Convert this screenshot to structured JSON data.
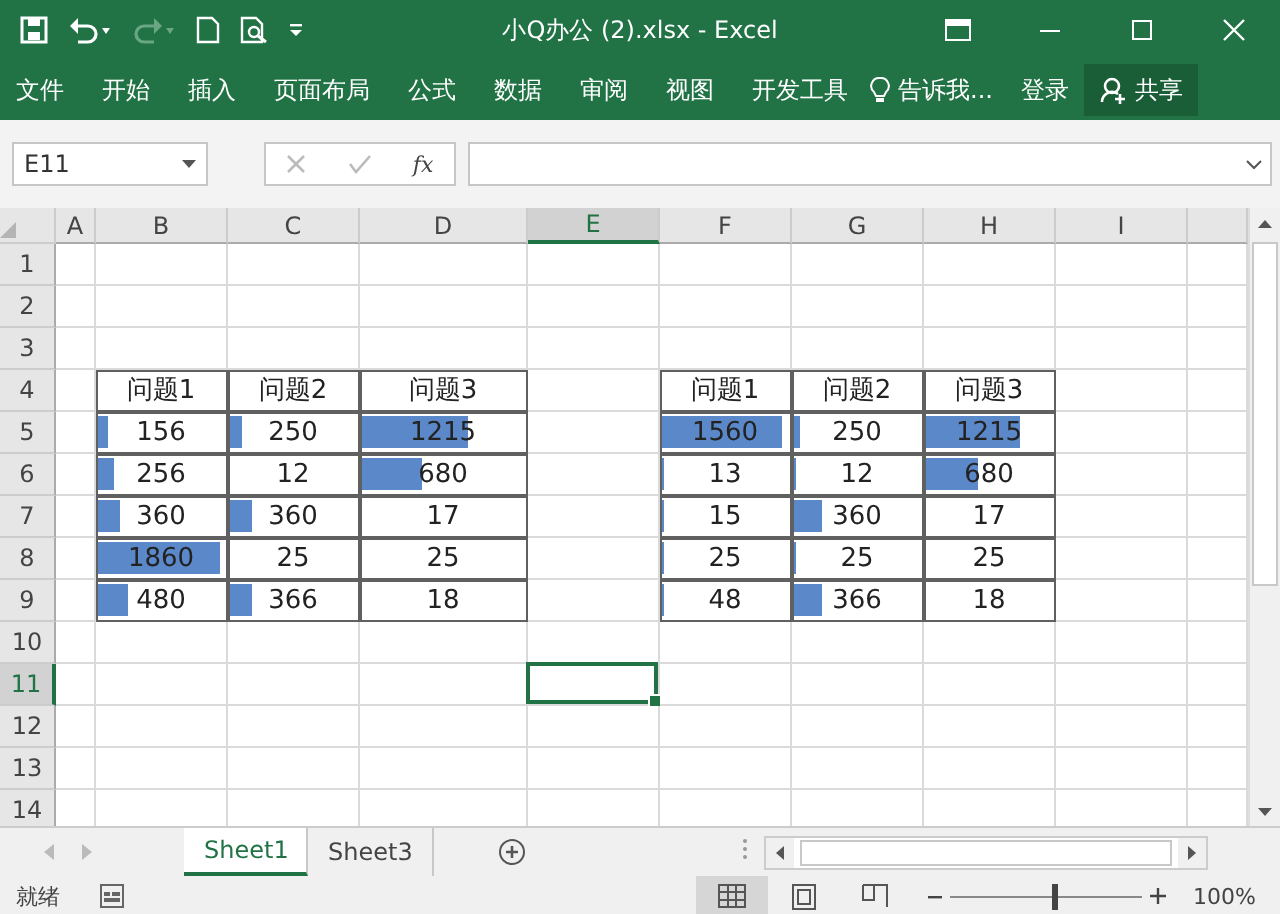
{
  "window": {
    "title": "小Q办公 (2).xlsx - Excel"
  },
  "ribbon": {
    "tabs": [
      {
        "label": "文件",
        "selected": false
      },
      {
        "label": "开始",
        "selected": false
      },
      {
        "label": "插入",
        "selected": false
      },
      {
        "label": "页面布局",
        "selected": false
      },
      {
        "label": "公式",
        "selected": false
      },
      {
        "label": "数据",
        "selected": false
      },
      {
        "label": "审阅",
        "selected": false
      },
      {
        "label": "视图",
        "selected": false
      },
      {
        "label": "开发工具",
        "selected": false
      }
    ],
    "tell_me": "告诉我...",
    "sign_in": "登录",
    "share": "共享"
  },
  "formula_bar": {
    "name_box": "E11",
    "function_label": "fx"
  },
  "sheet": {
    "columns": [
      {
        "label": "A",
        "selected": false
      },
      {
        "label": "B",
        "selected": false
      },
      {
        "label": "C",
        "selected": false
      },
      {
        "label": "D",
        "selected": false
      },
      {
        "label": "E",
        "selected": true
      },
      {
        "label": "F",
        "selected": false
      },
      {
        "label": "G",
        "selected": false
      },
      {
        "label": "H",
        "selected": false
      },
      {
        "label": "I",
        "selected": false
      }
    ],
    "rows": [
      {
        "label": "1",
        "selected": false
      },
      {
        "label": "2",
        "selected": false
      },
      {
        "label": "3",
        "selected": false
      },
      {
        "label": "4",
        "selected": false
      },
      {
        "label": "5",
        "selected": false
      },
      {
        "label": "6",
        "selected": false
      },
      {
        "label": "7",
        "selected": false
      },
      {
        "label": "8",
        "selected": false
      },
      {
        "label": "9",
        "selected": false
      },
      {
        "label": "10",
        "selected": false
      },
      {
        "label": "11",
        "selected": true
      },
      {
        "label": "12",
        "selected": false
      },
      {
        "label": "13",
        "selected": false
      },
      {
        "label": "14",
        "selected": false
      }
    ],
    "tables": [
      {
        "headers": [
          "问题1",
          "问题2",
          "问题3"
        ],
        "rows": [
          [
            {
              "value": "156",
              "level": 0.08
            },
            {
              "value": "250",
              "level": 0.1
            },
            {
              "value": "1215",
              "level": 0.66
            }
          ],
          [
            {
              "value": "256",
              "level": 0.12
            },
            {
              "value": "12"
            },
            {
              "value": "680",
              "level": 0.37
            }
          ],
          [
            {
              "value": "360",
              "level": 0.17
            },
            {
              "value": "360",
              "level": 0.17
            },
            {
              "value": "17"
            }
          ],
          [
            {
              "value": "1860",
              "level": 0.97
            },
            {
              "value": "25"
            },
            {
              "value": "25"
            }
          ],
          [
            {
              "value": "480",
              "level": 0.24
            },
            {
              "value": "366",
              "level": 0.17
            },
            {
              "value": "18"
            }
          ]
        ]
      },
      {
        "headers": [
          "问题1",
          "问题2",
          "问题3"
        ],
        "rows": [
          [
            {
              "value": "1560",
              "level": 0.95
            },
            {
              "value": "250",
              "level": 0.05
            },
            {
              "value": "1215",
              "level": 0.74
            }
          ],
          [
            {
              "value": "13",
              "level": 0.02
            },
            {
              "value": "12",
              "level": 0.02
            },
            {
              "value": "680",
              "level": 0.42
            }
          ],
          [
            {
              "value": "15",
              "level": 0.02
            },
            {
              "value": "360",
              "level": 0.22
            },
            {
              "value": "17"
            }
          ],
          [
            {
              "value": "25",
              "level": 0.02
            },
            {
              "value": "25",
              "level": 0.02
            },
            {
              "value": "25"
            }
          ],
          [
            {
              "value": "48",
              "level": 0.02
            },
            {
              "value": "366",
              "level": 0.22
            },
            {
              "value": "18"
            }
          ]
        ]
      }
    ]
  },
  "sheet_tabs": [
    {
      "label": "Sheet1",
      "selected": true
    },
    {
      "label": "Sheet3",
      "selected": false
    }
  ],
  "status_bar": {
    "status": "就绪",
    "zoom": {
      "level": 0.55,
      "reading": "100%"
    }
  }
}
